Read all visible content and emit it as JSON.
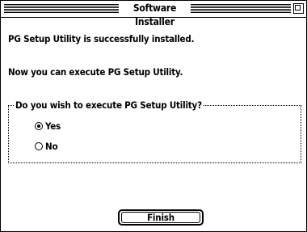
{
  "window": {
    "title": "Software Installer"
  },
  "messages": {
    "installed": "PG Setup Utility is successfully installed.",
    "can_execute": "Now you can execute PG Setup Utility."
  },
  "execute_group": {
    "legend": "Do you wish to execute PG Setup Utility?",
    "options": [
      {
        "label": "Yes",
        "selected": true
      },
      {
        "label": "No",
        "selected": false
      }
    ]
  },
  "buttons": {
    "finish": "Finish"
  }
}
